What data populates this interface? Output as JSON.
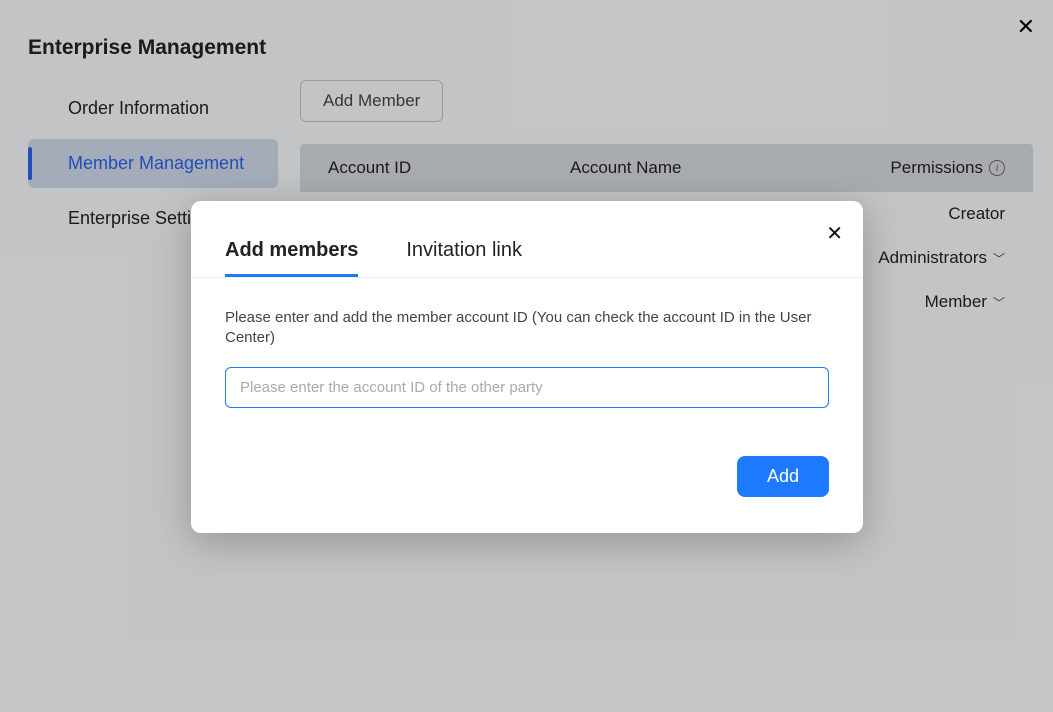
{
  "page": {
    "title": "Enterprise Management"
  },
  "sidebar": {
    "items": [
      {
        "label": "Order Information",
        "active": false
      },
      {
        "label": "Member Management",
        "active": true
      },
      {
        "label": "Enterprise Settings",
        "active": false
      }
    ]
  },
  "toolbar": {
    "add_member_label": "Add Member"
  },
  "table": {
    "headers": {
      "account_id": "Account ID",
      "account_name": "Account Name",
      "permissions": "Permissions"
    },
    "rows": [
      {
        "permission": "Creator",
        "has_dropdown": false
      },
      {
        "permission": "Administrators",
        "has_dropdown": true
      },
      {
        "permission": "Member",
        "has_dropdown": true
      }
    ]
  },
  "modal": {
    "tabs": {
      "add_members": "Add members",
      "invitation_link": "Invitation link"
    },
    "description": "Please enter and add the member account ID (You can check the account ID in the User Center)",
    "input_placeholder": "Please enter the account ID of the other party",
    "add_button_label": "Add"
  },
  "icons": {
    "close": "✕",
    "chevron_down": "⌄",
    "info": "i"
  }
}
